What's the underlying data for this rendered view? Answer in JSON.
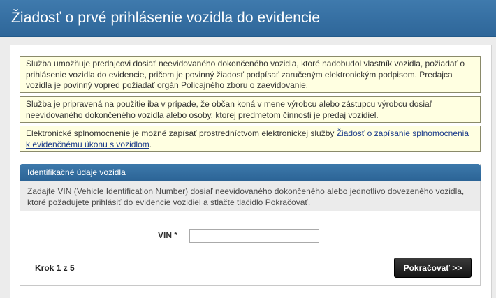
{
  "page": {
    "title": "Žiadosť o prvé prihlásenie vozidla do evidencie"
  },
  "notices": {
    "n1": "Služba umožňuje predajcovi dosiať neevidovaného dokončeného vozidla, ktoré nadobudol vlastník vozidla, požiadať o prihlásenie vozidla do evidencie, pričom je povinný žiadosť podpísať zaručeným elektronickým podpisom. Predajca vozidla je povinný vopred požiadať orgán Policajného zboru o zaevidovanie.",
    "n2": "Služba je pripravená na použitie iba v prípade, že občan koná v mene výrobcu alebo zástupcu výrobcu dosiaľ neevidovaného dokončeného vozidla alebo osoby, ktorej predmetom činnosti je predaj vozidiel.",
    "n3_prefix": "Elektronické splnomocnenie je možné zapísať prostredníctvom elektronickej služby ",
    "n3_link": "Žiadosť o zapísanie splnomocnenia k evidenčnému úkonu s vozidlom",
    "n3_suffix": "."
  },
  "identification": {
    "header": "Identifikačné údaje vozidla",
    "info": "Zadajte VIN (Vehicle Identification Number) dosiaľ neevidovaného dokončeného alebo jednotlivo dovezeného vozidla, ktoré požadujete prihlásiť do evidencie vozidiel a stlačte tlačidlo Pokračovať.",
    "vin_label": "VIN *",
    "vin_value": "",
    "step": "Krok 1 z 5",
    "continue_label": "Pokračovať >>"
  }
}
